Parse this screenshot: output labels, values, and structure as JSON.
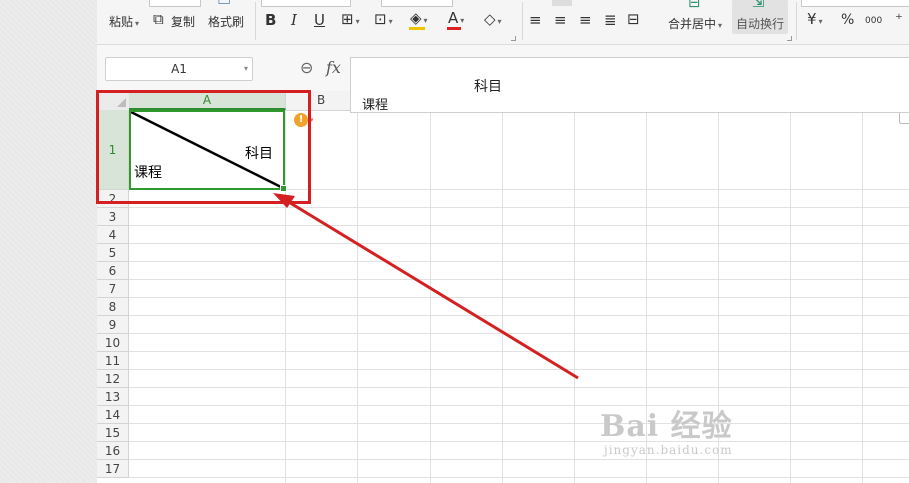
{
  "ribbon": {
    "paste_label": "粘贴",
    "copy_label": "复制",
    "format_painter_label": "格式刷",
    "bold": "B",
    "italic": "I",
    "underline": "U",
    "font_color_glyph": "A",
    "merge_center_label": "合并居中",
    "auto_wrap_label": "自动换行",
    "currency_glyph": "¥",
    "percent_glyph": "%",
    "thousands_glyph": "000",
    "highlight_color": "#f2c300",
    "font_color": "#e02020"
  },
  "formula_bar": {
    "name_box": "A1",
    "fx_label": "fx",
    "content_line1": "科目",
    "content_line2": "课程"
  },
  "sheet": {
    "columns": [
      "A",
      "B"
    ],
    "rows": [
      "1",
      "2",
      "3",
      "4",
      "5",
      "6",
      "7",
      "8",
      "9",
      "10",
      "11",
      "12",
      "13",
      "14",
      "15",
      "16",
      "17"
    ],
    "cell_a1": {
      "top_right_text": "科目",
      "bottom_left_text": "课程"
    },
    "selection_color": "#2e9a2e"
  },
  "annotation": {
    "color": "#d42020"
  },
  "watermark": {
    "main": "Bai 经验",
    "sub": "jingyan.baidu.com"
  }
}
